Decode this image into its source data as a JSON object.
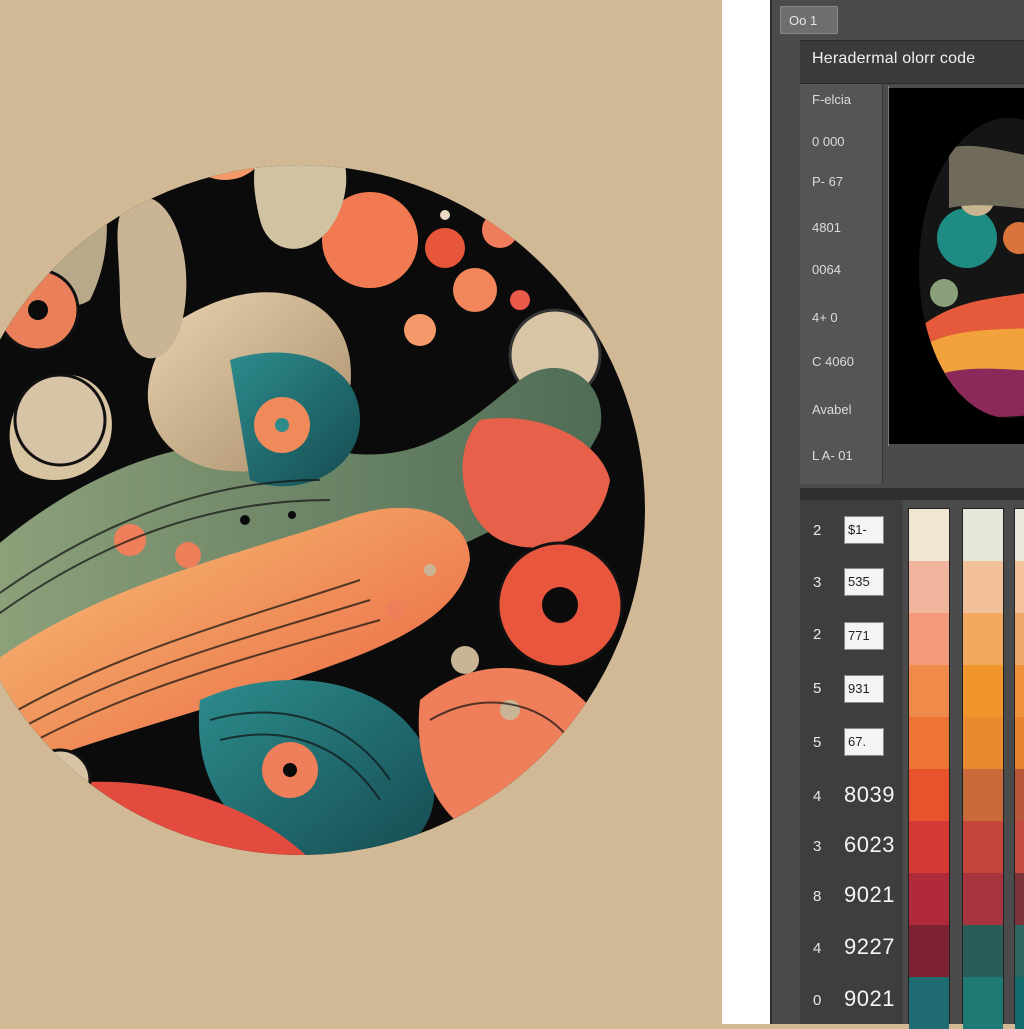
{
  "window": {
    "tab_label": "Oo 1",
    "title": "Heradermal olorr code"
  },
  "code_list": [
    "F-elcia",
    "0 000",
    "P- 67",
    "4801",
    "0064",
    "4+ 0",
    "C 4060",
    "Avabel",
    "L A- 01"
  ],
  "swatch_rows": [
    {
      "index": "2",
      "code": "$1-",
      "boxed": true
    },
    {
      "index": "3",
      "code": "535",
      "boxed": true
    },
    {
      "index": "2",
      "code": "771",
      "boxed": true
    },
    {
      "index": "5",
      "code": "931",
      "boxed": true
    },
    {
      "index": "5",
      "code": "67.",
      "boxed": true
    },
    {
      "index": "4",
      "code": "8039",
      "boxed": false
    },
    {
      "index": "3",
      "code": "6023",
      "boxed": false
    },
    {
      "index": "8",
      "code": "9021",
      "boxed": false
    },
    {
      "index": "4",
      "code": "9227",
      "boxed": false
    },
    {
      "index": "0",
      "code": "9021",
      "boxed": false
    }
  ],
  "swatch_columns": [
    [
      "#f3e5d4",
      "#f1b49c",
      "#f39a7c",
      "#f08a4a",
      "#ee7435",
      "#e8522d",
      "#d63a34",
      "#b02a3b",
      "#7c2230",
      "#1f6c72"
    ],
    [
      "#e6e7d8",
      "#f2c19a",
      "#f3a860",
      "#f1962c",
      "#e88a2f",
      "#c96a3a",
      "#c4453a",
      "#a63540",
      "#2b5d58",
      "#1f7a76"
    ],
    [
      "#eae9dc",
      "#f4c39c",
      "#f0a86a",
      "#ef9138",
      "#e7832d",
      "#b9573b",
      "#c24a3e",
      "#7a3338",
      "#2e6662",
      "#136b6e"
    ]
  ],
  "colors": {
    "art_background": "#d1b996",
    "panel_background": "#4b4b4b",
    "circle_fill": "#0b0b0b"
  }
}
